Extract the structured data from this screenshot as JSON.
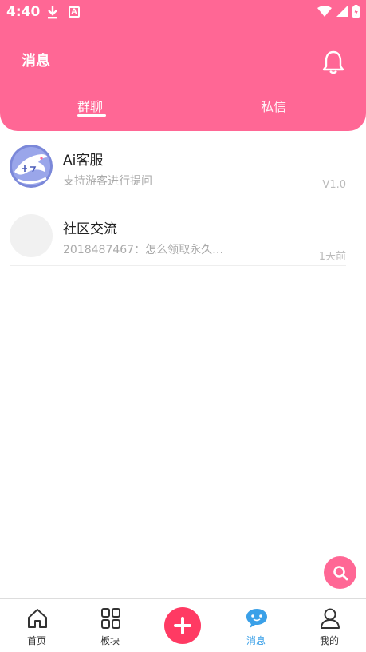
{
  "status": {
    "time": "4:40",
    "a_glyph": "A"
  },
  "header": {
    "title": "消息",
    "tabs": [
      {
        "label": "群聊",
        "active": true
      },
      {
        "label": "私信",
        "active": false
      }
    ]
  },
  "chats": [
    {
      "name": "Ai客服",
      "preview": "支持游客进行提问",
      "meta": "V1.0",
      "avatar_icon": "dolphin-logo-icon"
    },
    {
      "name": "社区交流",
      "preview": "2018487467：怎么领取永久…",
      "meta": "1天前",
      "avatar_icon": "blank-avatar"
    }
  ],
  "nav": [
    {
      "label": "首页",
      "icon": "home-icon"
    },
    {
      "label": "板块",
      "icon": "grid-icon"
    },
    {
      "label": "",
      "icon": "plus-icon"
    },
    {
      "label": "消息",
      "icon": "chat-face-icon",
      "active": true
    },
    {
      "label": "我的",
      "icon": "user-icon"
    }
  ],
  "colors": {
    "primary": "#ff6795",
    "plus": "#ff3a63",
    "active_nav": "#3aa0e8"
  }
}
